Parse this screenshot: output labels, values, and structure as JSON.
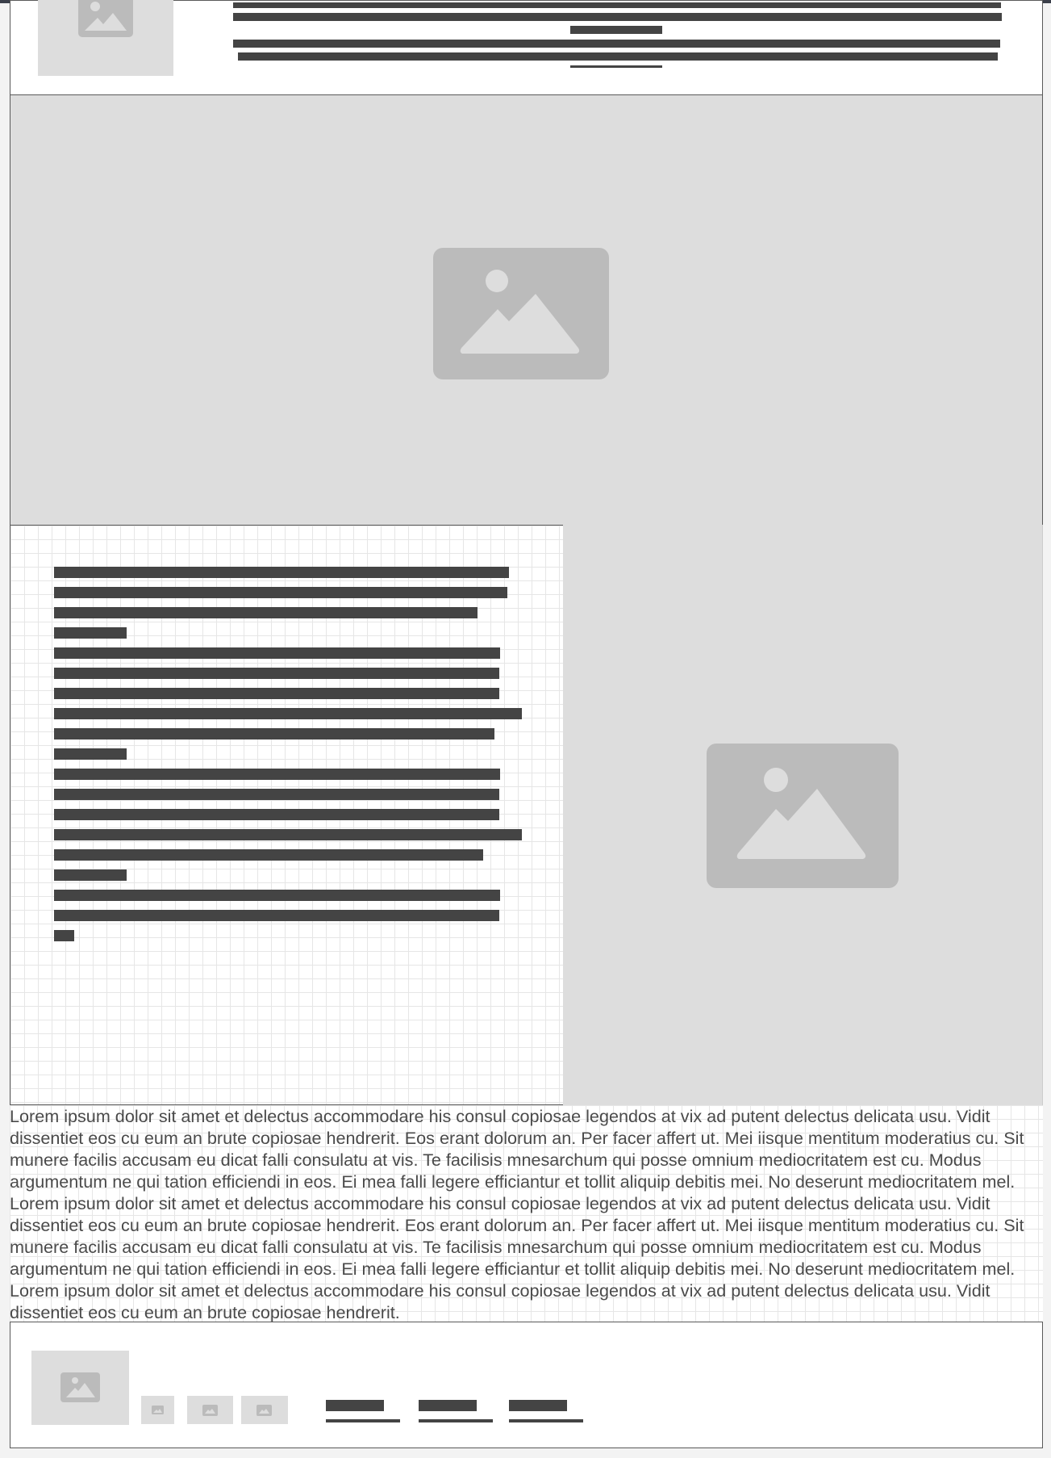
{
  "colors": {
    "placeholder_bg": "#dddddd",
    "placeholder_icon": "#bbbbbb",
    "text_bar": "#444444",
    "frame_border": "#5a5a5a",
    "top_accent": "#3b3f4a"
  },
  "icons": {
    "image_placeholder": "image-icon"
  },
  "body_text": "Lorem ipsum dolor sit amet et delectus accommodare his consul copiosae legendos at vix ad putent delectus delicata usu. Vidit dissentiet eos cu eum an brute copiosae hendrerit. Eos erant dolorum an. Per facer affert ut. Mei iisque mentitum moderatius cu. Sit munere facilis accusam eu dicat falli consulatu at vis. Te facilisis mnesarchum qui posse omnium mediocritatem est cu. Modus argumentum ne qui tation efficiendi in eos. Ei mea falli legere efficiantur et tollit aliquip debitis mei. No deserunt mediocritatem mel. Lorem ipsum dolor sit amet et delectus accommodare his consul copiosae legendos at vix ad putent delectus delicata usu. Vidit dissentiet eos cu eum an brute copiosae hendrerit. Eos erant dolorum an. Per facer affert ut. Mei iisque mentitum moderatius cu. Sit munere facilis accusam eu dicat falli consulatu at vis. Te facilisis mnesarchum qui posse omnium mediocritatem est cu. Modus argumentum ne qui tation efficiendi in eos. Ei mea falli legere efficiantur et tollit aliquip debitis mei. No deserunt mediocritatem mel. Lorem ipsum dolor sit amet et delectus accommodare his consul copiosae legendos at vix ad putent delectus delicata usu. Vidit dissentiet eos cu eum an brute copiosae hendrerit."
}
